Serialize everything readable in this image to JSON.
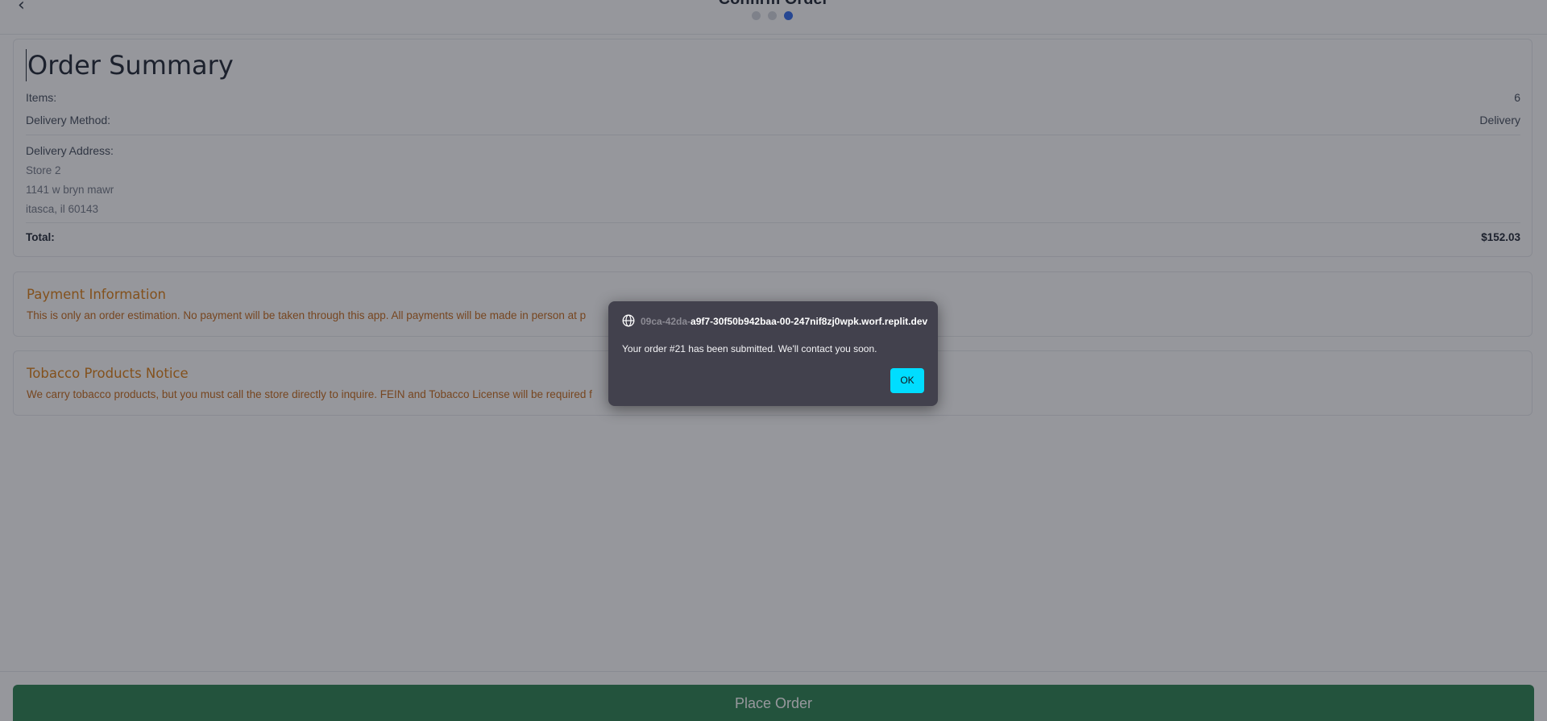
{
  "header": {
    "back_label": "‹",
    "title": "Confirm Order",
    "step_count": 3,
    "active_step": 3
  },
  "summary": {
    "title": "Order Summary",
    "items_label": "Items:",
    "items_value": "6",
    "method_label": "Delivery Method:",
    "method_value": "Delivery",
    "address_label": "Delivery Address:",
    "address_lines": [
      "Store 2",
      "1141 w bryn mawr",
      "itasca, il 60143"
    ],
    "total_label": "Total:",
    "total_value": "$152.03"
  },
  "payment_notice": {
    "title": "Payment Information",
    "text": "This is only an order estimation. No payment will be taken through this app. All payments will be made in person at p"
  },
  "tobacco_notice": {
    "title": "Tobacco Products Notice",
    "text": "We carry tobacco products, but you must call the store directly to inquire. FEIN and Tobacco License will be required f"
  },
  "footer": {
    "place_order_label": "Place Order"
  },
  "dialog": {
    "origin_faded": "09ca-42da-",
    "origin_main": "a9f7-30f50b942baa-00-247nif8zj0wpk.worf.replit.dev",
    "message": "Your order #21 has been submitted. We'll contact you soon.",
    "ok_label": "OK"
  },
  "colors": {
    "accent": "#2563eb",
    "notice": "#d97706",
    "place_order": "#1f7a45",
    "dialog_bg": "#42414d",
    "dialog_button": "#00ddff"
  },
  "icons": {
    "back": "chevron-left-icon",
    "globe": "globe-icon"
  }
}
